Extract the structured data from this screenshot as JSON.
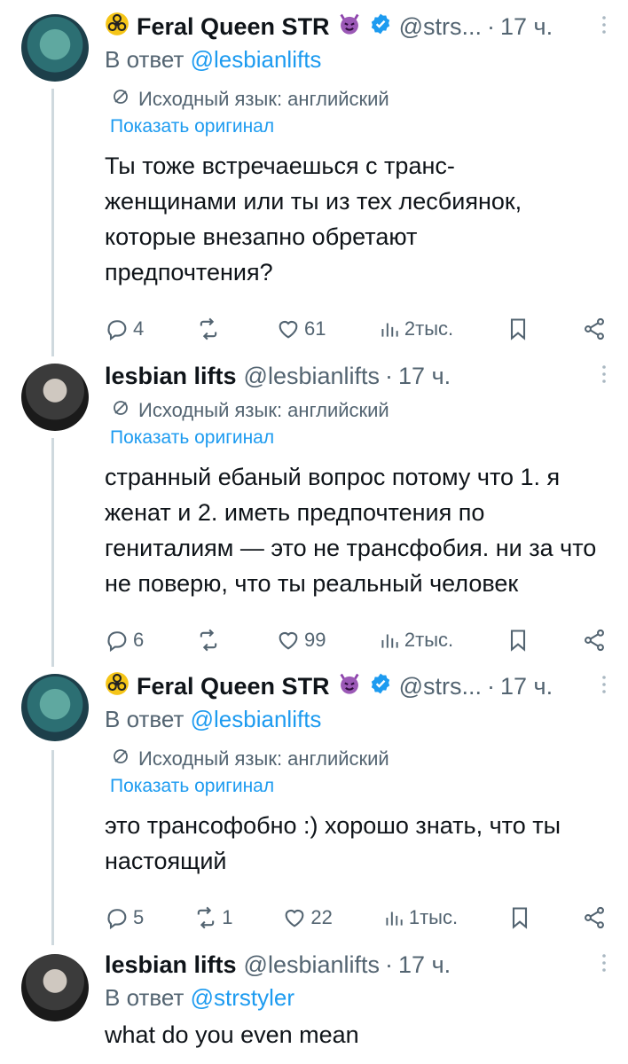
{
  "tweets": [
    {
      "name": "Feral Queen STR",
      "handle": "@strs...",
      "time": "17 ч.",
      "reply_prefix": "В ответ",
      "reply_to": "@lesbianlifts",
      "translated_note": "Исходный язык: английский",
      "show_original": "Показать оригинал",
      "text": "Ты тоже встречаешься с транс-женщинами или ты из тех лесбиянок, которые внезапно обретают предпочтения?",
      "replies": "4",
      "reposts": "",
      "likes": "61",
      "views": "2тыс."
    },
    {
      "name": "lesbian lifts",
      "handle": "@lesbianlifts",
      "time": "17 ч.",
      "translated_note": "Исходный язык: английский",
      "show_original": "Показать оригинал",
      "text": "странный ебаный вопрос потому что 1. я женат и 2. иметь предпочтения по гениталиям — это не трансфобия. ни за что не поверю, что ты реальный человек",
      "replies": "6",
      "reposts": "",
      "likes": "99",
      "views": "2тыс."
    },
    {
      "name": "Feral Queen STR",
      "handle": "@strs...",
      "time": "17 ч.",
      "reply_prefix": "В ответ",
      "reply_to": "@lesbianlifts",
      "translated_note": "Исходный язык: английский",
      "show_original": "Показать оригинал",
      "text": "это трансофобно :) хорошо знать, что ты настоящий",
      "replies": "5",
      "reposts": "1",
      "likes": "22",
      "views": "1тыс."
    },
    {
      "name": "lesbian lifts",
      "handle": "@lesbianlifts",
      "time": "17 ч.",
      "reply_prefix": "В ответ",
      "reply_to": "@strstyler",
      "text": "what do you even mean"
    }
  ],
  "colors": {
    "accent": "#1d9bf0",
    "muted": "#536471",
    "thread": "#cfd9de"
  },
  "icons": [
    "biohazard-icon",
    "devil-emoji-icon",
    "verified-badge-icon",
    "more-icon",
    "translate-icon",
    "reply-icon",
    "repost-icon",
    "like-icon",
    "views-icon",
    "bookmark-icon",
    "share-icon"
  ]
}
